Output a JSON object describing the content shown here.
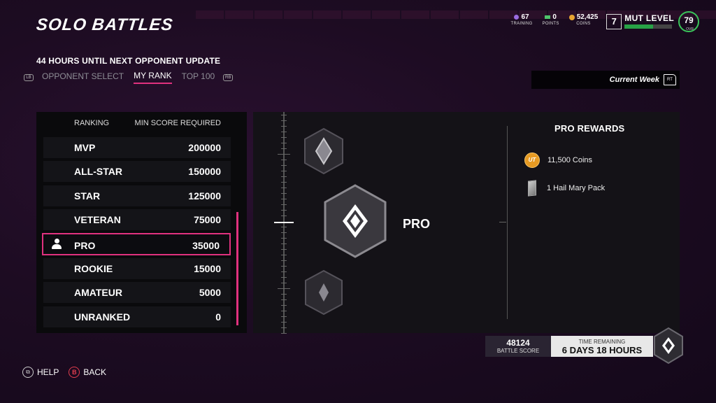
{
  "title": "SOLO BATTLES",
  "subtitle": "44 HOURS UNTIL NEXT OPPONENT UPDATE",
  "tabs": {
    "left_bumper": "LB",
    "right_bumper": "RB",
    "items": [
      "OPPONENT SELECT",
      "MY RANK",
      "TOP 100"
    ],
    "active": "MY RANK"
  },
  "hud": {
    "training": {
      "value": "67",
      "label": "TRAINING"
    },
    "points": {
      "value": "0",
      "label": "POINTS"
    },
    "coins": {
      "value": "52,425",
      "label": "COINS"
    },
    "mut_level_number": "7",
    "mut_level_label": "MUT LEVEL",
    "mut_level_progress": 0.6,
    "ovr_value": "79",
    "ovr_label": "OVR"
  },
  "week_selector": {
    "label": "Current Week",
    "trigger": "RT"
  },
  "ranking_table": {
    "header_ranking": "RANKING",
    "header_min_score": "MIN SCORE REQUIRED",
    "rows": [
      {
        "name": "MVP",
        "score": "200000"
      },
      {
        "name": "ALL-STAR",
        "score": "150000"
      },
      {
        "name": "STAR",
        "score": "125000"
      },
      {
        "name": "VETERAN",
        "score": "75000"
      },
      {
        "name": "PRO",
        "score": "35000"
      },
      {
        "name": "ROOKIE",
        "score": "15000"
      },
      {
        "name": "AMATEUR",
        "score": "5000"
      },
      {
        "name": "UNRANKED",
        "score": "0"
      }
    ],
    "selected": "PRO"
  },
  "detail": {
    "selected_rank": "PRO",
    "rewards_title": "PRO REWARDS",
    "coin_icon_text": "UT",
    "rewards": [
      {
        "icon": "coins-icon",
        "label": "11,500 Coins"
      },
      {
        "icon": "pack-icon",
        "label": "1 Hail Mary Pack"
      }
    ]
  },
  "battle_score": {
    "value": "48124",
    "label": "BATTLE SCORE"
  },
  "time_remaining": {
    "label": "TIME REMAINING",
    "value": "6 DAYS 18 HOURS"
  },
  "footer": {
    "help_button": "HELP",
    "help_glyph": "⧉",
    "back_button": "BACK",
    "back_glyph": "B"
  },
  "colors": {
    "accent": "#e0317e",
    "level_bar": "#27a246",
    "coin": "#e69a23"
  }
}
